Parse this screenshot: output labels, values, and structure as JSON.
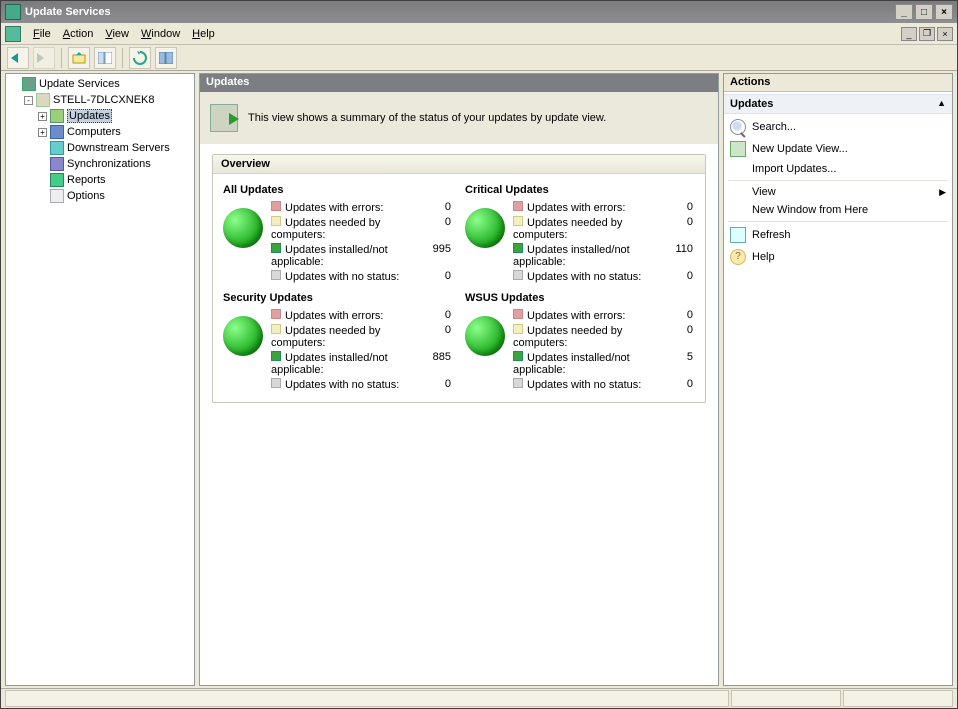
{
  "window": {
    "title": "Update Services"
  },
  "menu": {
    "file": "File",
    "action": "Action",
    "view": "View",
    "window": "Window",
    "help": "Help"
  },
  "tree": {
    "root": "Update Services",
    "server": "STELL-7DLCXNEK8",
    "updates": "Updates",
    "computers": "Computers",
    "downstream": "Downstream Servers",
    "sync": "Synchronizations",
    "reports": "Reports",
    "options": "Options"
  },
  "middle": {
    "header": "Updates",
    "description": "This view shows a summary of the status of your updates by update view.",
    "overview": "Overview",
    "labels": {
      "errors": "Updates with errors:",
      "needed": "Updates needed by computers:",
      "installed": "Updates installed/not applicable:",
      "nostatus": "Updates with no status:"
    },
    "cards": [
      {
        "title": "All Updates",
        "errors": 0,
        "needed": 0,
        "installed": 995,
        "nostatus": 0
      },
      {
        "title": "Critical Updates",
        "errors": 0,
        "needed": 0,
        "installed": 110,
        "nostatus": 0
      },
      {
        "title": "Security Updates",
        "errors": 0,
        "needed": 0,
        "installed": 885,
        "nostatus": 0
      },
      {
        "title": "WSUS Updates",
        "errors": 0,
        "needed": 0,
        "installed": 5,
        "nostatus": 0
      }
    ]
  },
  "actions": {
    "header": "Actions",
    "section": "Updates",
    "search": "Search...",
    "newview": "New Update View...",
    "import": "Import Updates...",
    "view": "View",
    "newwin": "New Window from Here",
    "refresh": "Refresh",
    "help": "Help"
  }
}
